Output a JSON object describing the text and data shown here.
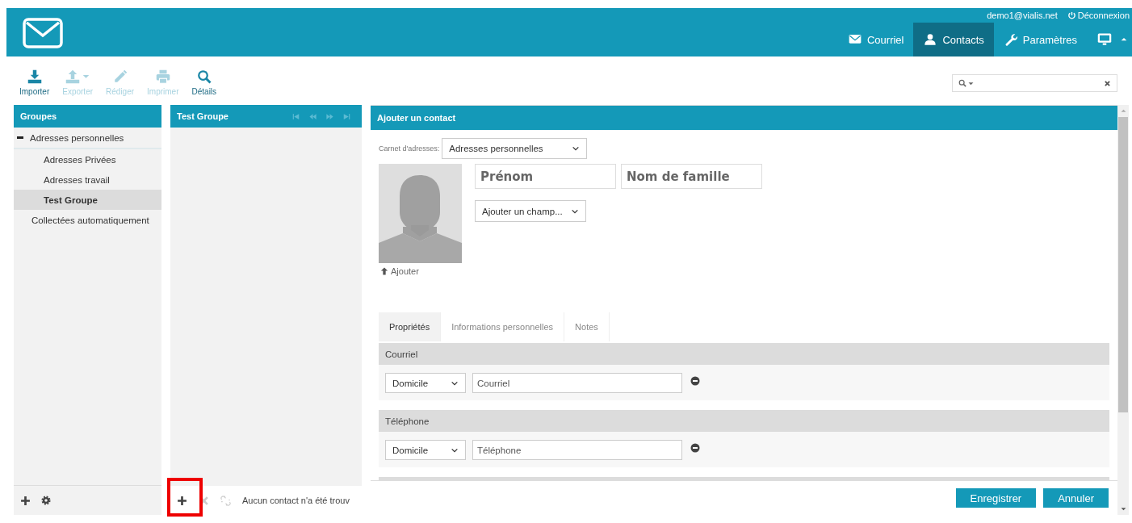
{
  "header": {
    "user": "demo1@vialis.net",
    "logout": "Déconnexion",
    "nav": [
      {
        "label": "Courriel",
        "selected": false
      },
      {
        "label": "Contacts",
        "selected": true
      },
      {
        "label": "Paramètres",
        "selected": false
      }
    ]
  },
  "toolbar": [
    {
      "label": "Importer",
      "disabled": false
    },
    {
      "label": "Exporter",
      "disabled": true,
      "has_menu": true
    },
    {
      "label": "Rédiger",
      "disabled": true
    },
    {
      "label": "Imprimer",
      "disabled": true
    },
    {
      "label": "Détails",
      "disabled": false
    }
  ],
  "groups": {
    "title": "Groupes",
    "items": [
      {
        "label": "Adresses personnelles",
        "selected": false,
        "expanded": true,
        "children": [
          {
            "label": "Adresses Privées",
            "selected": false
          },
          {
            "label": "Adresses travail",
            "selected": false
          },
          {
            "label": "Test Groupe",
            "selected": true
          }
        ]
      },
      {
        "label": "Collectées automatiquement",
        "selected": false
      }
    ]
  },
  "contact_list": {
    "title": "Test Groupe",
    "footer_buttons": [
      {
        "disabled": false,
        "highlighted": true
      },
      {
        "disabled": true,
        "highlighted": false
      },
      {
        "disabled": true,
        "highlighted": false
      }
    ],
    "message": "Aucun contact n'a été trouv"
  },
  "contact_form": {
    "title": "Ajouter un contact",
    "address_book_label": "Carnet d'adresses:",
    "address_book": "Adresses personnelles",
    "first_name": {
      "placeholder": "Prénom"
    },
    "last_name": {
      "placeholder": "Nom de famille"
    },
    "add_field": "Ajouter un champ...",
    "upload": "Ajouter",
    "tabs": [
      {
        "label": "Propriétés",
        "selected": true
      },
      {
        "label": "Informations personnelles",
        "selected": false
      },
      {
        "label": "Notes",
        "selected": false
      }
    ],
    "sections": [
      {
        "title": "Courriel",
        "rows": [
          {
            "type": "Domicile",
            "placeholder": "Courriel"
          }
        ]
      },
      {
        "title": "Téléphone",
        "rows": [
          {
            "type": "Domicile",
            "placeholder": "Téléphone"
          }
        ]
      }
    ],
    "actions": [
      "Enregistrer",
      "Annuler"
    ]
  }
}
